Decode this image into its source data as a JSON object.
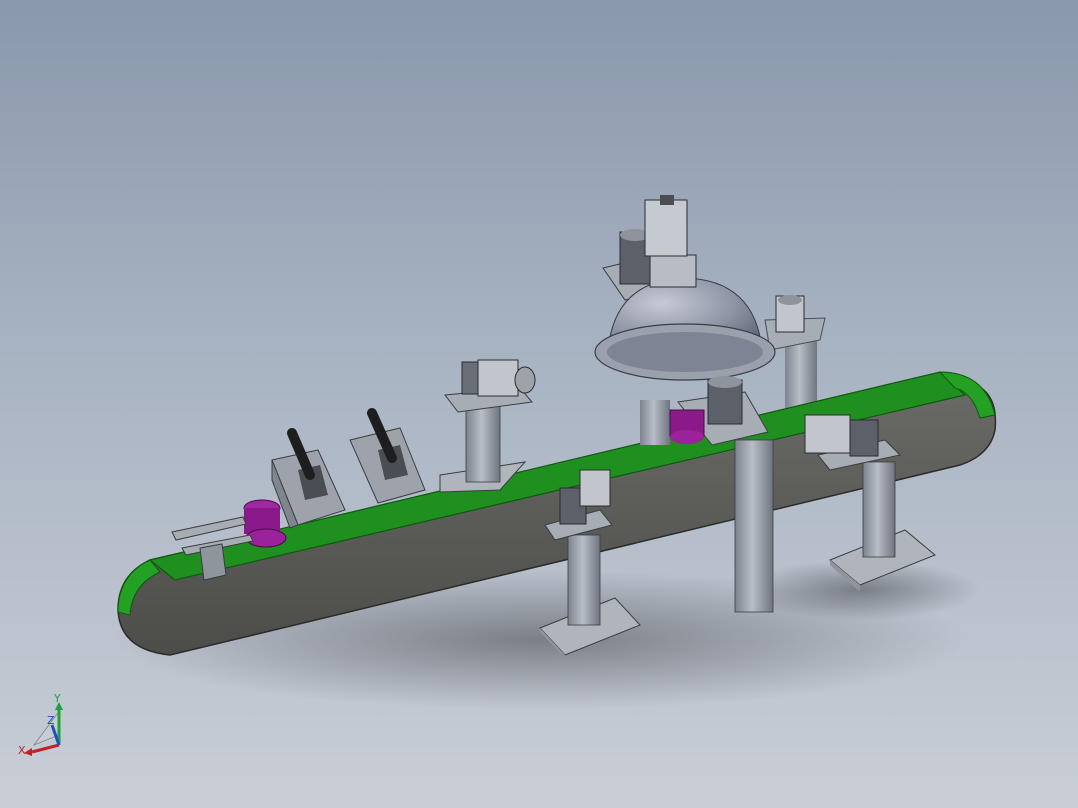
{
  "viewport": {
    "background_top": "#8a98ac",
    "background_bottom": "#c9ced6"
  },
  "model": {
    "belt_color": "#1f8f1f",
    "frame_color": "#5b5b5b",
    "steel_color": "#9aa0a8",
    "part_color": "#8a1a8a",
    "dome_color": "#8d93a3"
  },
  "triad": {
    "x_label": "X",
    "y_label": "Y",
    "z_label": "Z",
    "x_color": "#c0202a",
    "y_color": "#20a040",
    "z_color": "#2050c0"
  }
}
